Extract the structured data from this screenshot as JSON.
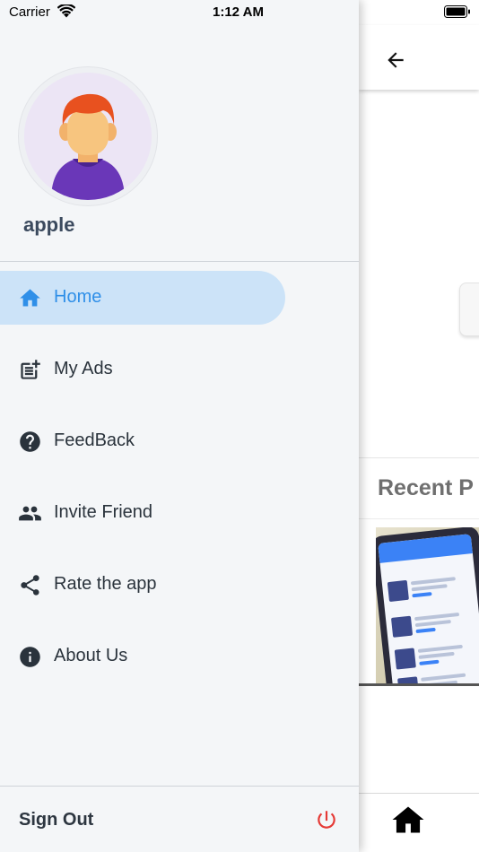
{
  "status_bar": {
    "carrier": "Carrier",
    "time": "1:12 AM",
    "wifi_icon": "wifi-icon",
    "battery_icon": "battery-icon"
  },
  "drawer": {
    "username": "apple",
    "avatar_icon": "user-avatar",
    "menu": [
      {
        "label": "Home",
        "icon": "home-icon",
        "active": true
      },
      {
        "label": "My Ads",
        "icon": "post-add-icon",
        "active": false
      },
      {
        "label": "FeedBack",
        "icon": "help-icon",
        "active": false
      },
      {
        "label": "Invite Friend",
        "icon": "people-icon",
        "active": false
      },
      {
        "label": "Rate the app",
        "icon": "share-icon",
        "active": false
      },
      {
        "label": "About Us",
        "icon": "info-icon",
        "active": false
      }
    ],
    "sign_out_label": "Sign Out",
    "sign_out_icon": "power-icon"
  },
  "background_page": {
    "back_icon": "arrow-back-icon",
    "section_title": "Recent P",
    "bottom_nav_icon": "home-icon"
  },
  "colors": {
    "accent": "#2f8fe8",
    "active_bg": "#cce3f8",
    "drawer_bg": "#f4f6f8",
    "power_red": "#e53935"
  }
}
